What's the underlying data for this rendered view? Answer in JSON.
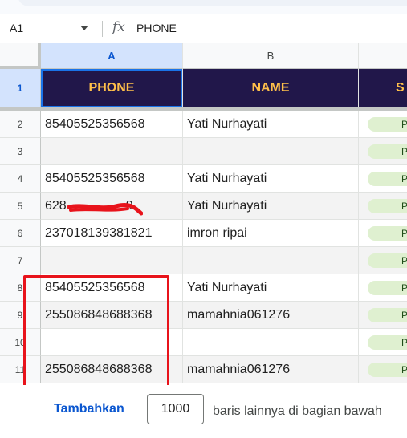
{
  "formula_bar": {
    "cell_ref": "A1",
    "fx_label": "fx",
    "value": "PHONE"
  },
  "columns": [
    {
      "label": "A"
    },
    {
      "label": "B"
    }
  ],
  "header_row": {
    "row_num": "1",
    "cells": [
      "PHONE",
      "NAME",
      "S"
    ]
  },
  "rows": [
    {
      "num": "2",
      "phone": "85405525356568",
      "name": "Yati Nurhayati",
      "status": "P"
    },
    {
      "num": "3",
      "phone": "",
      "name": "",
      "status": "P"
    },
    {
      "num": "4",
      "phone": "85405525356568",
      "name": "Yati Nurhayati",
      "status": "P"
    },
    {
      "num": "5",
      "phone": "628",
      "phone_tail": "9",
      "name": "Yati Nurhayati",
      "status": "P"
    },
    {
      "num": "6",
      "phone": "237018139381821",
      "name": "imron ripai",
      "status": "P"
    },
    {
      "num": "7",
      "phone": "",
      "name": "",
      "status": "P"
    },
    {
      "num": "8",
      "phone": "85405525356568",
      "name": "Yati Nurhayati",
      "status": "P"
    },
    {
      "num": "9",
      "phone": "255086848688368",
      "name": "mamahnia061276",
      "status": "P"
    },
    {
      "num": "10",
      "phone": "",
      "name": "",
      "status": "P"
    },
    {
      "num": "11",
      "phone": "255086848688368",
      "name": "mamahnia061276",
      "status": "P"
    }
  ],
  "footer": {
    "add_label": "Tambahkan",
    "rows_value": "1000",
    "suffix_text": "baris lainnya di bagian bawah"
  },
  "colors": {
    "header_bg": "#21174a",
    "header_text": "#ffc04a",
    "highlight": "#e8131b",
    "redaction": "#e8131b",
    "active": "#1a73e8"
  }
}
